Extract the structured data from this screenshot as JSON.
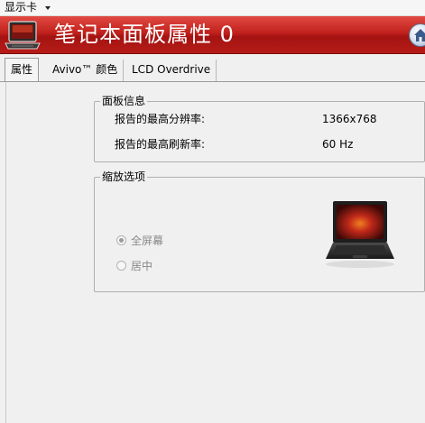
{
  "menubar": {
    "display_card_label": "显示卡"
  },
  "banner": {
    "title": "笔记本面板属性 0",
    "laptop_icon": "laptop-icon",
    "home_icon": "home-icon"
  },
  "tabs": [
    {
      "label": "属性",
      "active": true
    },
    {
      "label": "Avivo™ 颜色",
      "active": false
    },
    {
      "label": "LCD Overdrive",
      "active": false
    }
  ],
  "panel_info": {
    "legend": "面板信息",
    "rows": [
      {
        "label": "报告的最高分辨率:",
        "value": "1366x768"
      },
      {
        "label": "报告的最高刷新率:",
        "value": "60 Hz"
      }
    ]
  },
  "scaling": {
    "legend": "缩放选项",
    "options": [
      {
        "label": "全屏幕",
        "checked": true,
        "enabled": false
      },
      {
        "label": "居中",
        "checked": false,
        "enabled": false
      }
    ],
    "preview_icon": "laptop-preview-image"
  },
  "colors": {
    "banner_red": "#b51b17",
    "background": "#f0f0f0"
  }
}
